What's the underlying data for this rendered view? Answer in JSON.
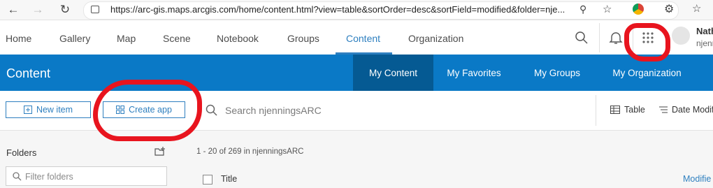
{
  "browser": {
    "url": "https://arc-gis.maps.arcgis.com/home/content.html?view=table&sortOrder=desc&sortField=modified&folder=nje...",
    "icons": [
      "back-icon",
      "forward-icon",
      "reload-icon",
      "lock-icon",
      "zoom-icon",
      "favorite-add-icon",
      "chrome-extension-icon",
      "extensions-icon",
      "favorites-icon"
    ]
  },
  "topnav": {
    "items": [
      "Home",
      "Gallery",
      "Map",
      "Scene",
      "Notebook",
      "Groups",
      "Content",
      "Organization"
    ],
    "active": "Content",
    "user_name": "Nath",
    "user_handle": "njenn"
  },
  "content_header": {
    "title": "Content",
    "tabs": [
      "My Content",
      "My Favorites",
      "My Groups",
      "My Organization"
    ],
    "active_tab": "My Content"
  },
  "toolbar": {
    "new_item_label": "New item",
    "create_app_label": "Create app",
    "search_placeholder": "Search njenningsARC",
    "view_label": "Table",
    "sort_label": "Date Modifi"
  },
  "folders": {
    "label": "Folders",
    "filter_placeholder": "Filter folders"
  },
  "results": {
    "count_text": "1 - 20 of 269 in njenningsARC",
    "title_header": "Title",
    "modified_header": "Modifie"
  },
  "colors": {
    "brand_blue": "#0a79c6",
    "active_tab": "#055a93",
    "link": "#2e7fbf",
    "annotation_red": "#e8141e"
  }
}
